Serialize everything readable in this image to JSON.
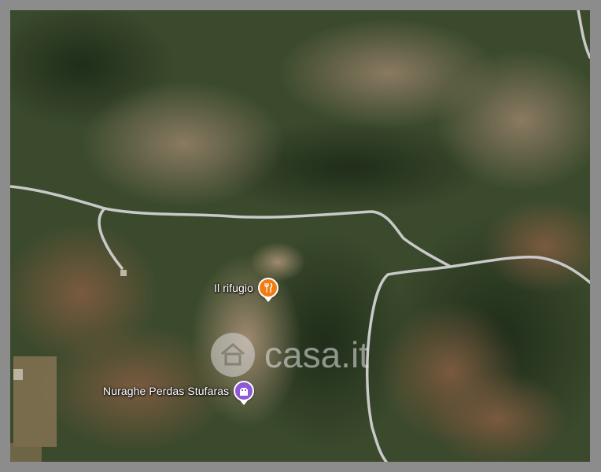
{
  "map": {
    "view": "satellite",
    "colors": {
      "frame": "#8c8c8c",
      "road": "#c9c9c9",
      "restaurant_pin": "#f07c14",
      "monument_pin": "#8e59d6"
    },
    "pois": [
      {
        "label": "Il rifugio",
        "icon": "restaurant-icon"
      },
      {
        "label": "Nuraghe Perdas Stufaras",
        "icon": "castle-icon"
      }
    ]
  },
  "watermark": {
    "text": "casa.it",
    "icon": "house-icon"
  }
}
